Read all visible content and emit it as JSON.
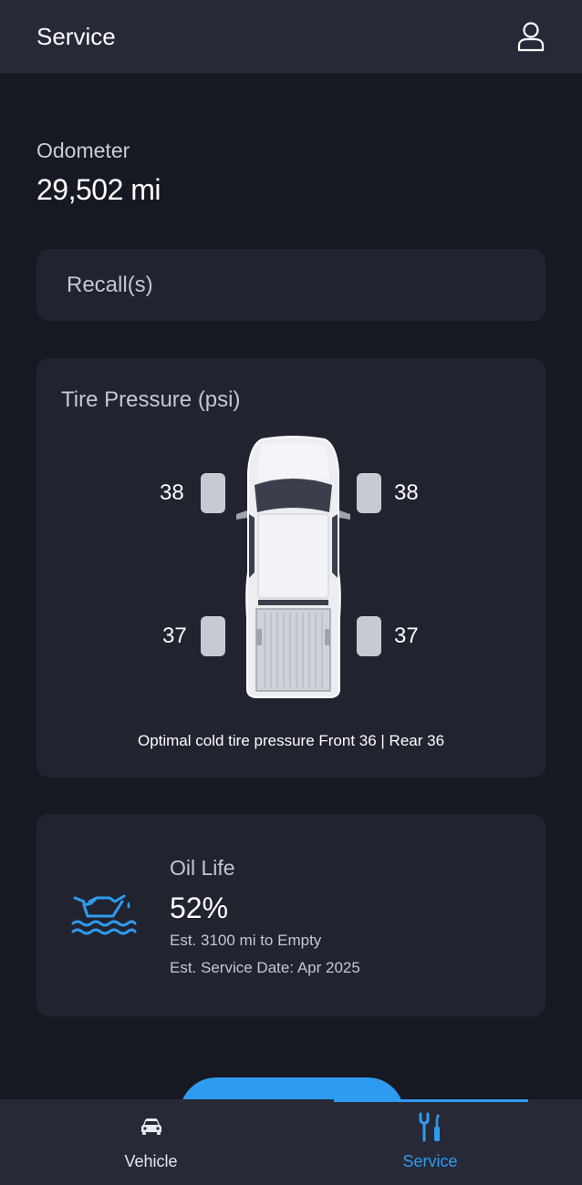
{
  "header": {
    "title": "Service",
    "profile_icon": "user-icon"
  },
  "odometer": {
    "label": "Odometer",
    "value": "29,502 mi"
  },
  "recall": {
    "label": "Recall(s)"
  },
  "tire_pressure": {
    "title": "Tire Pressure (psi)",
    "front_left": "38",
    "front_right": "38",
    "rear_left": "37",
    "rear_right": "37",
    "note": "Optimal cold tire pressure Front 36 | Rear 36"
  },
  "oil_life": {
    "icon": "oil-can-icon",
    "title": "Oil Life",
    "value": "52%",
    "est_empty": "Est. 3100 mi to Empty",
    "est_service": "Est. Service Date: Apr 2025"
  },
  "nav": {
    "items": [
      {
        "label": "Vehicle",
        "icon": "car-icon",
        "active": false
      },
      {
        "label": "Service",
        "icon": "tools-icon",
        "active": true
      }
    ]
  },
  "colors": {
    "accent": "#2f9bf0",
    "background": "#161922",
    "card": "#21242f",
    "bar": "#272a36"
  }
}
